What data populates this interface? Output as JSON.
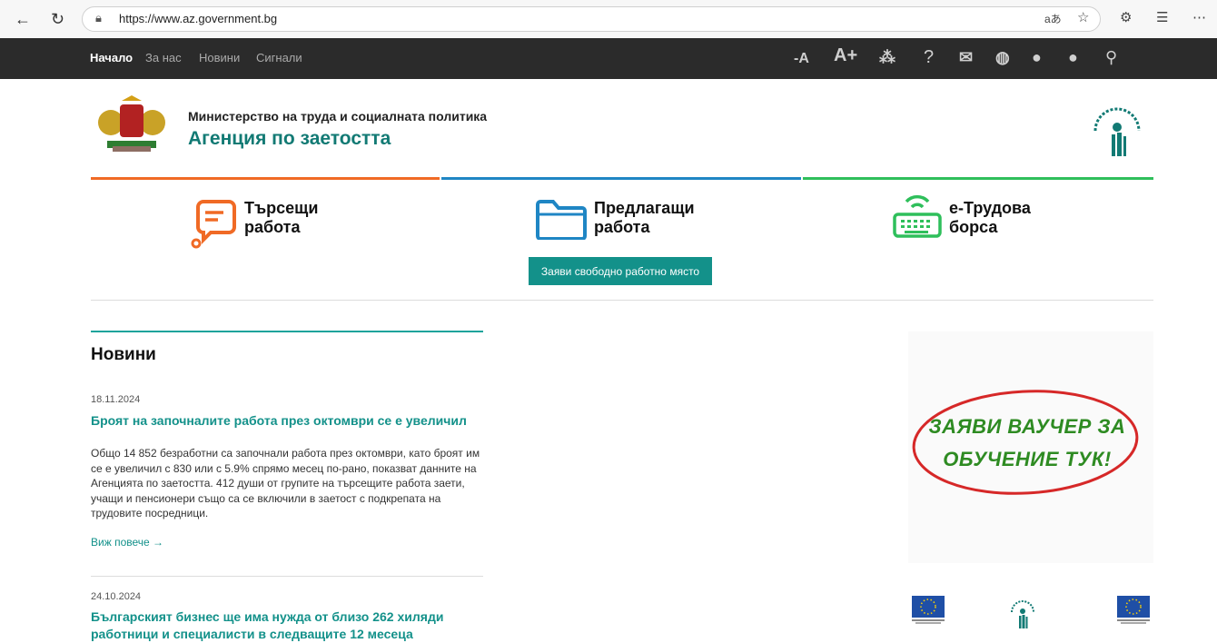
{
  "browser": {
    "url_host": "https://www.az.government.bg",
    "icons": [
      "back-arrow-icon",
      "reload-icon",
      "lock-icon",
      "read-aloud-icon",
      "favorite-star-icon",
      "extensions-icon",
      "favorites-list-icon",
      "more-icon"
    ]
  },
  "nav": {
    "links": [
      "Начало",
      "За нас",
      "Новини",
      "Сигнали"
    ],
    "tools": [
      "-A",
      "A+",
      "⁂",
      "?",
      "✉",
      "◍",
      "●",
      "●",
      "⚲"
    ]
  },
  "header": {
    "ministry": "Министерство на труда и социалната политика",
    "agency": "Агенция по заетостта"
  },
  "categories": [
    {
      "line1": "Търсещи",
      "line2": "работа",
      "color": "#f06a25"
    },
    {
      "line1": "Предлагащи",
      "line2": "работа",
      "color": "#1f86c4"
    },
    {
      "line1": "е-Трудова",
      "line2": "борса",
      "color": "#2fbf5b"
    }
  ],
  "cta": "Заяви свободно работно място",
  "news": {
    "heading": "Новини",
    "items": [
      {
        "date": "18.11.2024",
        "title": "Броят на започналите работа през октомври се е увеличил",
        "excerpt": "Общо 14 852 безработни са започнали работа през октомври, като броят им се е увеличил с 830 или с 5.9% спрямо месец по-рано, показват данните на Агенцията по заетостта. 412 души от групите на търсещите работа заети, учащи и пенсионери също са се включили в заетост с подкрепата на трудовите посредници.",
        "more": "Виж повече →"
      },
      {
        "date": "24.10.2024",
        "title": "Българският бизнес ще има нужда от близо 262 хиляди работници и специалисти в следващите 12 месеца"
      }
    ]
  },
  "voucher": {
    "line1": "ЗАЯВИ ВАУЧЕР ЗА",
    "line2": "ОБУЧЕНИЕ ТУК!"
  },
  "colors": {
    "teal": "#13918a",
    "orange": "#f06a25",
    "blue": "#1f86c4",
    "green": "#2fbf5b",
    "dark": "#2b2b2b"
  }
}
